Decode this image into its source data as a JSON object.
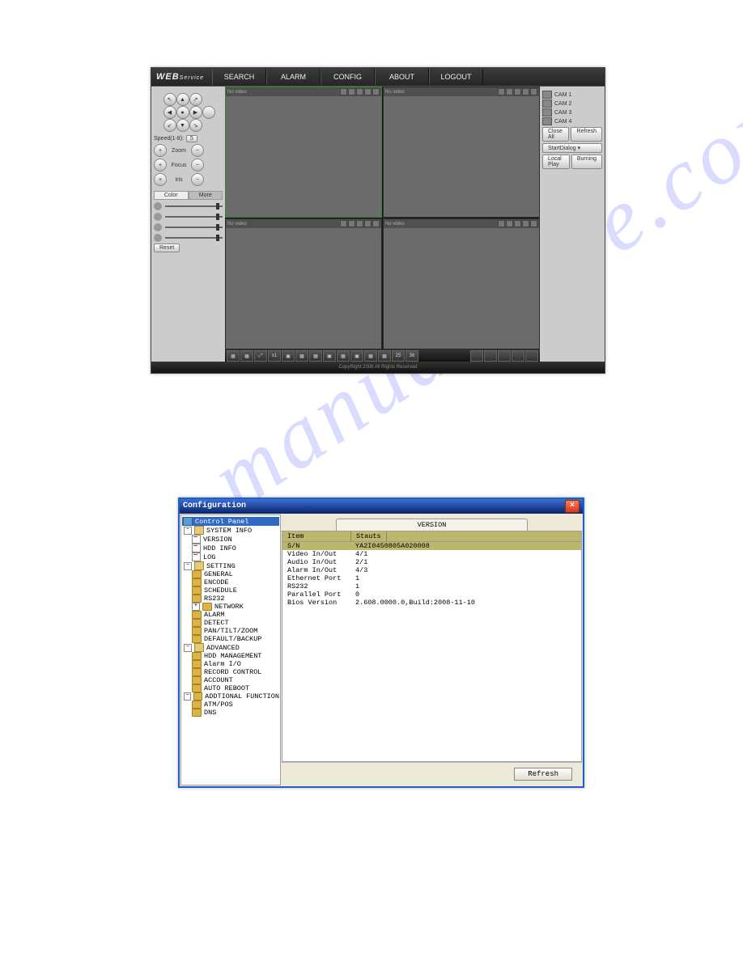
{
  "fig1": {
    "brand_main": "WEB",
    "brand_sub": "Service",
    "menu": [
      "SEARCH",
      "ALARM",
      "CONFIG",
      "ABOUT",
      "LOGOUT"
    ],
    "pane_label": "No video",
    "ptz": {
      "speed_label": "Speed(1-8):",
      "speed_value": "5",
      "zoom": "Zoom",
      "focus": "Focus",
      "iris": "Iris",
      "tab_color": "Color",
      "tab_more": "More",
      "reset": "Reset"
    },
    "right": {
      "cams": [
        "CAM 1",
        "CAM 2",
        "CAM 3",
        "CAM 4"
      ],
      "close_all": "Close All",
      "refresh": "Refresh",
      "start_dialog": "StartDialog ▾",
      "local_play": "Local Play",
      "burning": "Burning"
    },
    "footer": "CopyRight 2008 All Rights Reserved"
  },
  "fig2": {
    "title": "Configuration",
    "close": "×",
    "tree_root": "Control Panel",
    "tree": {
      "system_info": "SYSTEM INFO",
      "version": "VERSION",
      "hdd_info": "HDD INFO",
      "log": "LOG",
      "setting": "SETTING",
      "general": "GENERAL",
      "encode": "ENCODE",
      "schedule": "SCHEDULE",
      "rs232": "RS232",
      "network": "NETWORK",
      "alarm": "ALARM",
      "detect": "DETECT",
      "ptz": "PAN/TILT/ZOOM",
      "default_backup": "DEFAULT/BACKUP",
      "advanced": "ADVANCED",
      "hdd_mgmt": "HDD MANAGEMENT",
      "alarm_io": "Alarm I/O",
      "record_ctrl": "RECORD CONTROL",
      "account": "ACCOUNT",
      "auto_reboot": "AUTO REBOOT",
      "addtional_func": "ADDTIONAL FUNCTION",
      "atm_pos": "ATM/POS",
      "dns": "DNS"
    },
    "tab": "VERSION",
    "col_item": "Item",
    "col_status": "Stauts",
    "rows": [
      {
        "k": "S/N",
        "v": "YA2I0450805A020008"
      },
      {
        "k": "Video In/Out",
        "v": "4/1"
      },
      {
        "k": "Audio In/Out",
        "v": "2/1"
      },
      {
        "k": "Alarm In/Out",
        "v": "4/3"
      },
      {
        "k": "Ethernet Port",
        "v": "1"
      },
      {
        "k": "RS232",
        "v": "1"
      },
      {
        "k": "Parallel Port",
        "v": "0"
      },
      {
        "k": "Bios Version",
        "v": "2.608.0000.0,Build:2008-11-10"
      }
    ],
    "refresh": "Refresh"
  }
}
